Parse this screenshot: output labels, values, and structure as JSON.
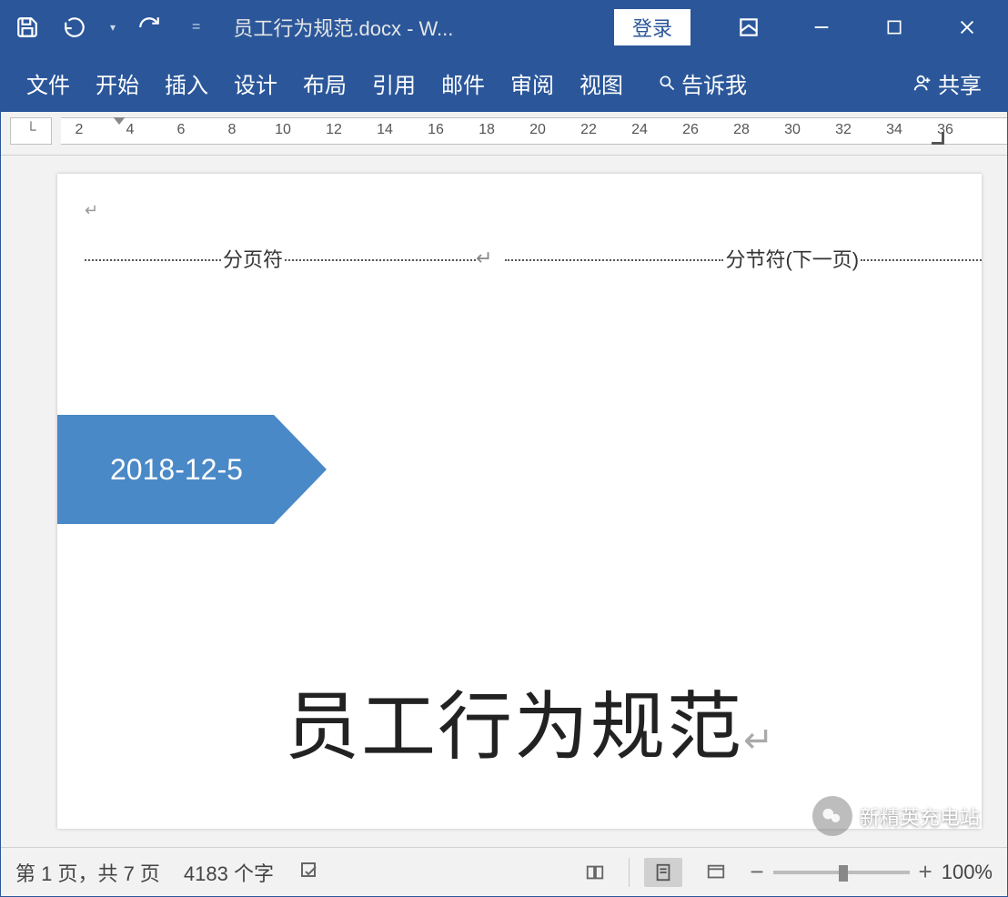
{
  "titlebar": {
    "doc_title": "员工行为规范.docx  -  W...",
    "login_label": "登录"
  },
  "ribbon": {
    "file": "文件",
    "home": "开始",
    "insert": "插入",
    "design": "设计",
    "layout": "布局",
    "references": "引用",
    "mailings": "邮件",
    "review": "审阅",
    "view": "视图",
    "tellme": "告诉我",
    "share": "共享"
  },
  "ruler": {
    "nums": [
      "2",
      "4",
      "6",
      "8",
      "10",
      "12",
      "14",
      "16",
      "18",
      "20",
      "22",
      "24",
      "26",
      "28",
      "30",
      "32",
      "34",
      "36"
    ]
  },
  "document": {
    "page_break_label": "分页符",
    "section_break_label": "分节符(下一页)",
    "date_text": "2018-12-5",
    "title_text": "员工行为规范"
  },
  "statusbar": {
    "page_info": "第 1 页，共 7 页",
    "word_count": "4183 个字",
    "zoom_pct": "100%"
  },
  "watermark": {
    "label": "新精英充电站"
  }
}
